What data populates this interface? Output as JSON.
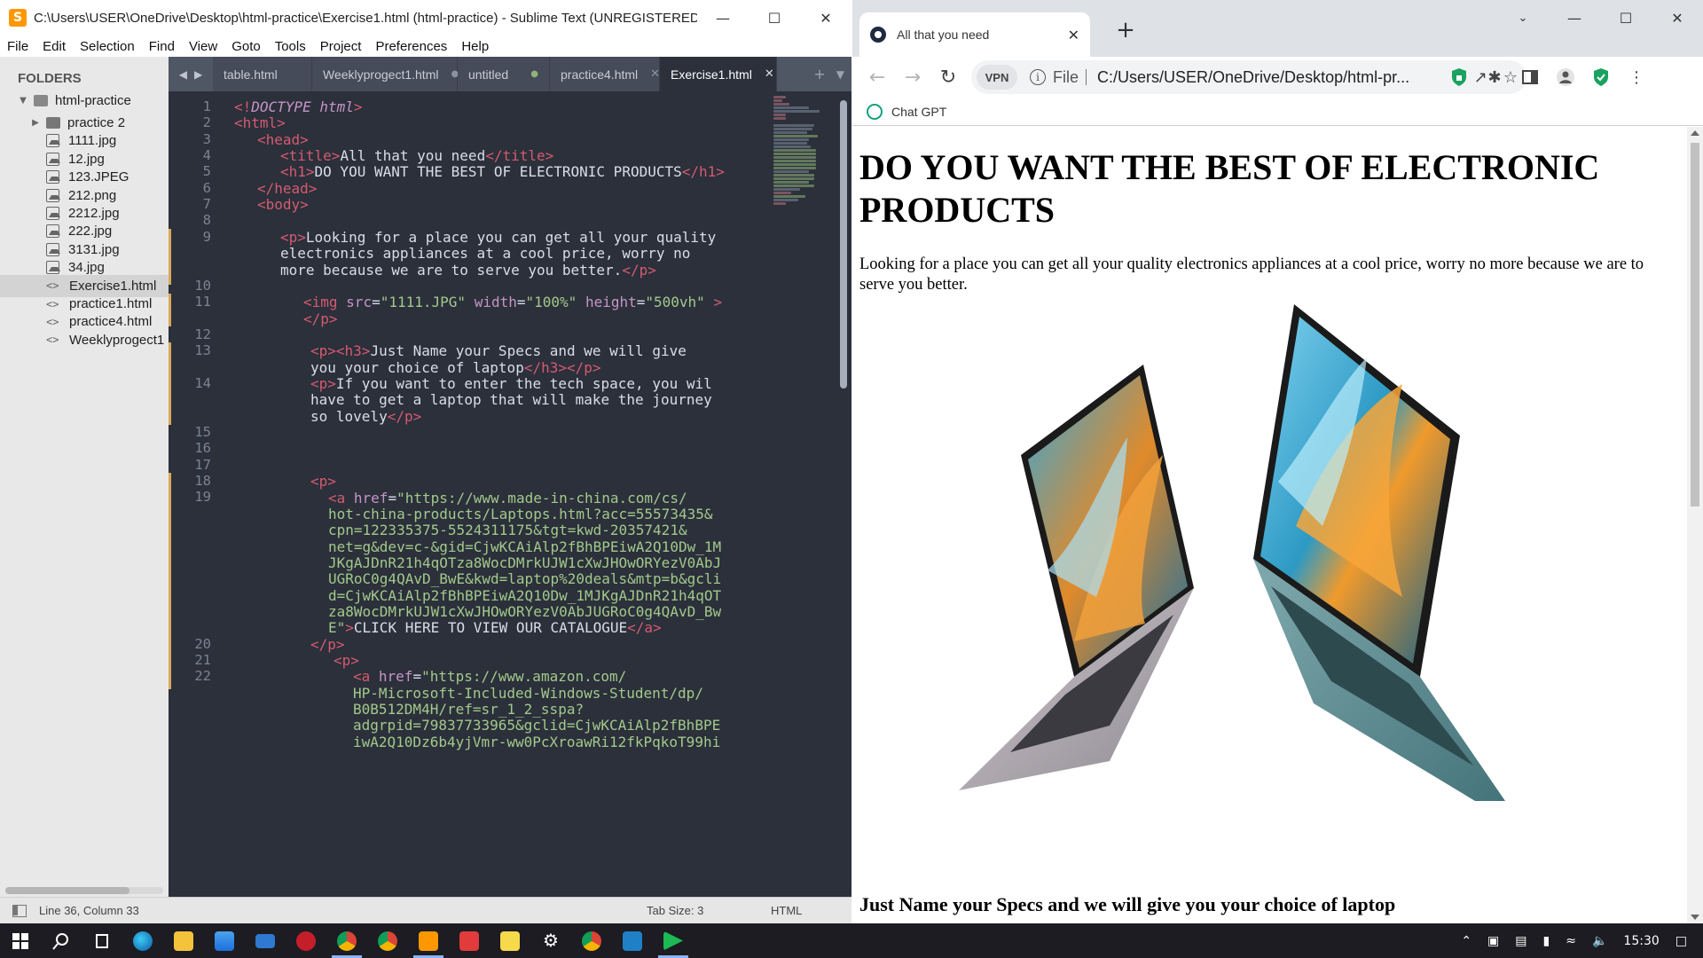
{
  "sublime": {
    "window_title": "C:\\Users\\USER\\OneDrive\\Desktop\\html-practice\\Exercise1.html (html-practice) - Sublime Text (UNREGISTERED)",
    "menu": [
      "File",
      "Edit",
      "Selection",
      "Find",
      "View",
      "Goto",
      "Tools",
      "Project",
      "Preferences",
      "Help"
    ],
    "sidebar": {
      "header": "FOLDERS",
      "root": "html-practice",
      "items": [
        {
          "label": "practice 2",
          "kind": "folder"
        },
        {
          "label": "1111.jpg",
          "kind": "image"
        },
        {
          "label": "12.jpg",
          "kind": "image"
        },
        {
          "label": "123.JPEG",
          "kind": "image"
        },
        {
          "label": "212.png",
          "kind": "image"
        },
        {
          "label": "2212.jpg",
          "kind": "image"
        },
        {
          "label": "222.jpg",
          "kind": "image"
        },
        {
          "label": "3131.jpg",
          "kind": "image"
        },
        {
          "label": "34.jpg",
          "kind": "image"
        },
        {
          "label": "Exercise1.html",
          "kind": "code",
          "selected": true
        },
        {
          "label": "practice1.html",
          "kind": "code"
        },
        {
          "label": "practice4.html",
          "kind": "code"
        },
        {
          "label": "Weeklyprogect1",
          "kind": "code"
        }
      ]
    },
    "tabs": [
      {
        "label": "table.html",
        "marker": ""
      },
      {
        "label": "Weeklyprogect1.html",
        "marker": "dot"
      },
      {
        "label": "untitled",
        "marker": "dot-green"
      },
      {
        "label": "practice4.html",
        "marker": "x"
      },
      {
        "label": "Exercise1.html",
        "marker": "x",
        "active": true
      }
    ],
    "gutter": [
      "1",
      "2",
      "3",
      "4",
      "5",
      "6",
      "7",
      "8",
      "9",
      "",
      "",
      "10",
      "11",
      "",
      "12",
      "13",
      "",
      "14",
      "",
      "",
      "15",
      "16",
      "17",
      "18",
      "19",
      "",
      "",
      "",
      "",
      "",
      "",
      "",
      "",
      "20",
      "21",
      "22",
      "",
      "",
      "",
      "",
      ""
    ],
    "status": {
      "position": "Line 36, Column 33",
      "tab_size": "Tab Size: 3",
      "syntax": "HTML"
    }
  },
  "chrome": {
    "tab_title": "All that you need",
    "vpn_badge": "VPN",
    "url_scheme": "File",
    "url": "C:/Users/USER/OneDrive/Desktop/html-pr...",
    "bookmark": "Chat GPT",
    "page": {
      "h1": "DO YOU WANT THE BEST OF ELECTRONIC PRODUCTS",
      "paragraph": "Looking for a place you can get all your quality electronics appliances at a cool price, worry no more because we are to serve you better.",
      "h3": "Just Name your Specs and we will give you your choice of laptop"
    }
  },
  "taskbar": {
    "clock": "15:30"
  }
}
